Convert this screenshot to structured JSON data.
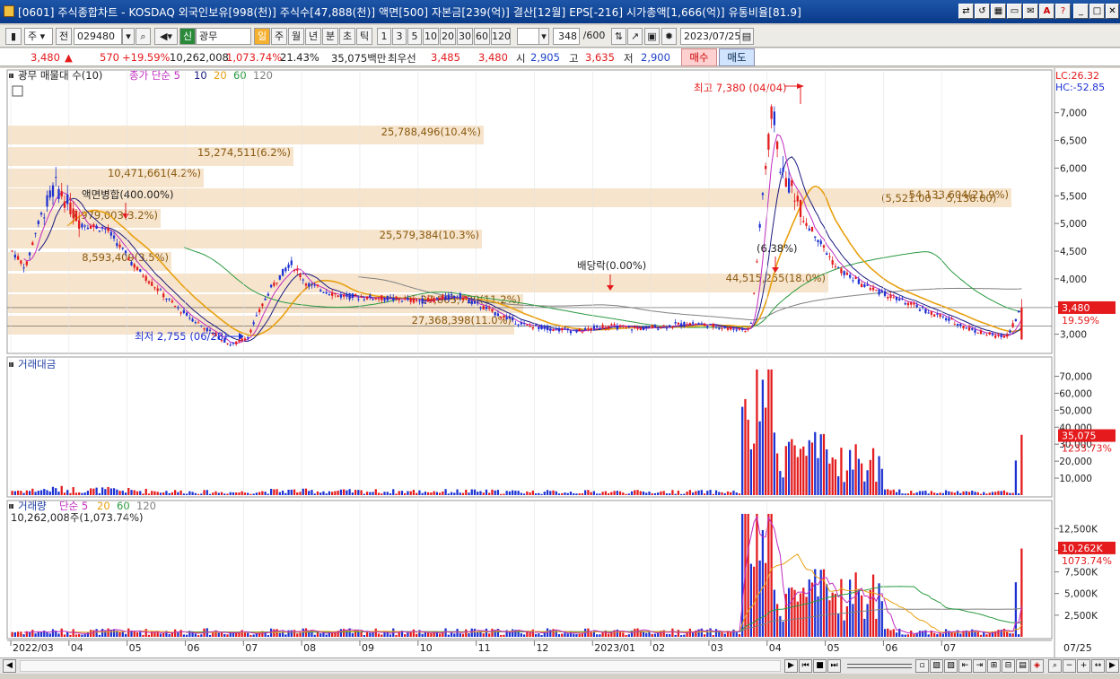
{
  "window": {
    "title": "[0601] 주식종합차트 - KOSDAQ 외국인보유[998(천)] 주식수[47,888(천)] 액면[500] 자본금[239(억)] 결산[12월] EPS[-216] 시가총액[1,666(억)] 유통비율[81.9]"
  },
  "toolbar": {
    "period": "주",
    "prev": "전",
    "code": "029480",
    "name": "광무",
    "name_prefix": "신",
    "periods": [
      "일",
      "주",
      "월",
      "년",
      "분",
      "초",
      "틱"
    ],
    "active_period": "일",
    "nums": [
      "1",
      "3",
      "5",
      "10",
      "20",
      "30",
      "60",
      "120"
    ],
    "count": "348",
    "count_total": "/600",
    "date": "2023/07/25"
  },
  "infobar": {
    "price": "3,480",
    "arrow": "▲",
    "change": "570",
    "rate": "+19.59%",
    "volume": "10,262,008",
    "vol_rate": "1,073.74%",
    "turnover": "21.43%",
    "amount": "35,075백만",
    "best_label": "최우선",
    "ask": "3,485",
    "bid": "3,480",
    "open_label": "시",
    "open": "2,905",
    "high_label": "고",
    "high": "3,635",
    "low_label": "저",
    "low": "2,900",
    "buy": "매수",
    "sell": "매도"
  },
  "price_panel": {
    "legend_title": "광무 매물대 수(10)",
    "ma_title": "종가 단순 5",
    "ma_periods": [
      "10",
      "20",
      "60",
      "120"
    ],
    "lc": "LC:26.32",
    "hc": "HC:-52.85",
    "y_ticks": [
      "7,000",
      "6,500",
      "6,000",
      "5,500",
      "5,000",
      "4,500",
      "4,000",
      "3,500",
      "3,000"
    ],
    "last_price": "3,480",
    "last_rate": "19.59%",
    "high_note": "최고 7,380 (04/04)",
    "low_note": "최저 2,755 (06/28)",
    "split_note": "액면병합(400.00%)",
    "div_note": "배당락(0.00%)",
    "pct_note": "(6.38%)",
    "range_note": "(5,521.00 ~ 5,138.00)",
    "profile_labels": [
      "25,788,496(10.4%)",
      "15,274,511(6.2%)",
      "10,471,661(4.2%)",
      "7,979,003(3.2%)",
      "54,133,604(21.9%)",
      "25,579,384(10.3%)",
      "8,593,409(3.5%)",
      "44,515,255(18.0%)",
      "27,803,729(11.2%)",
      "27,368,398(11.0%)"
    ]
  },
  "amount_panel": {
    "title": "거래대금",
    "y_ticks": [
      "70,000",
      "60,000",
      "50,000",
      "40,000",
      "30,000",
      "20,000",
      "10,000"
    ],
    "last_value": "35,075",
    "last_rate": "1233.73%"
  },
  "volume_panel": {
    "title": "거래량",
    "ma_title": "단순 5",
    "ma_periods": [
      "20",
      "60",
      "120"
    ],
    "sub": "10,262,008주(1,073.74%)",
    "y_ticks": [
      "12,500K",
      "10,000K",
      "7,500K",
      "5,000K",
      "2,500K"
    ],
    "last_value": "10,262K",
    "last_rate": "1073.74%"
  },
  "xaxis": {
    "labels": [
      "2022/03",
      "04",
      "05",
      "06",
      "07",
      "08",
      "09",
      "10",
      "11",
      "12",
      "2023/01",
      "02",
      "03",
      "04",
      "05",
      "06",
      "07"
    ],
    "end_label": "07/25"
  },
  "colors": {
    "up": "#e41a1c",
    "down": "#1e32d2",
    "ma5": "#c02cc0",
    "ma10": "#1a1a80",
    "ma20": "#e8a010",
    "ma60": "#2a9a40",
    "ma120": "#808080",
    "profile": "#f6e4cc"
  },
  "chart_data": {
    "type": "candlestick",
    "price_range": [
      2750,
      7400
    ],
    "monthly_close": [
      4500,
      4900,
      4400,
      3300,
      3000,
      3700,
      3600,
      3600,
      3550,
      3400,
      3150,
      3100,
      3050,
      6500,
      4200,
      3500,
      3300,
      3480
    ],
    "volume_profile_pct": [
      10.4,
      6.2,
      4.2,
      3.2,
      21.9,
      10.3,
      3.5,
      18.0,
      11.2,
      11.0
    ]
  }
}
